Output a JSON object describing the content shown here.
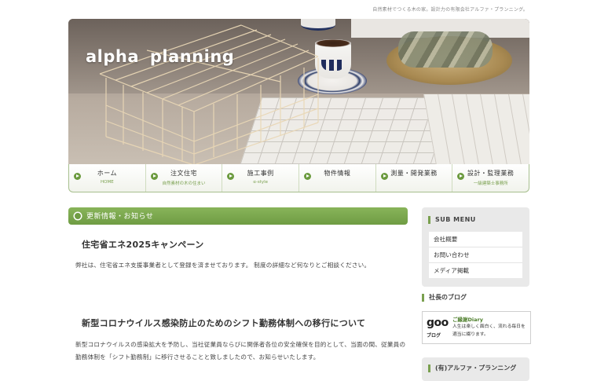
{
  "header": {
    "tagline": "自然素材でつくる木の家。設計力の有限会社アルファ・プランニング。",
    "site_title": "alpha  planning"
  },
  "nav": [
    {
      "label": "ホーム",
      "sub": "HOME"
    },
    {
      "label": "注文住宅",
      "sub": "自然素材の木の住まい"
    },
    {
      "label": "施工事例",
      "sub": "α-style"
    },
    {
      "label": "物件情報",
      "sub": ""
    },
    {
      "label": "測量・開発業務",
      "sub": ""
    },
    {
      "label": "設計・監理業務",
      "sub": "一級建築士事務所"
    }
  ],
  "main": {
    "section_title": "更新情報・お知らせ",
    "posts": [
      {
        "title": "住宅省エネ2025キャンペーン",
        "body": "弊社は、住宅省エネ支援事業者として登録を済ませております。 制度の詳細など何なりとご相談ください。"
      },
      {
        "title": "新型コロナウイルス感染防止のためのシフト勤務体制への移行について",
        "body": "新型コロナウイルスの感染拡大を予防し、当社従業員ならびに関係者各位の安全確保を目的として、当面の間、従業員の勤務体制を「シフト勤務制」に移行させることと致しましたので、お知らせいたします。"
      }
    ]
  },
  "sidebar": {
    "submenu_title": "SUB MENU",
    "submenu_items": [
      "会社概要",
      "お問い合わせ",
      "メディア掲載"
    ],
    "blog_title": "社長のブログ",
    "blog": {
      "logo": "goo",
      "logo_sub": "ブログ",
      "name": "ご縁謝Diary",
      "description": "人生は楽しく面白く、流れる毎日を適当に綴ります。"
    },
    "company_title": "(有)アルファ・プランニング"
  },
  "colors": {
    "accent_green": "#6f9c43",
    "nav_border": "#a7bf8e",
    "sidebar_bg": "#e9e9e9"
  }
}
